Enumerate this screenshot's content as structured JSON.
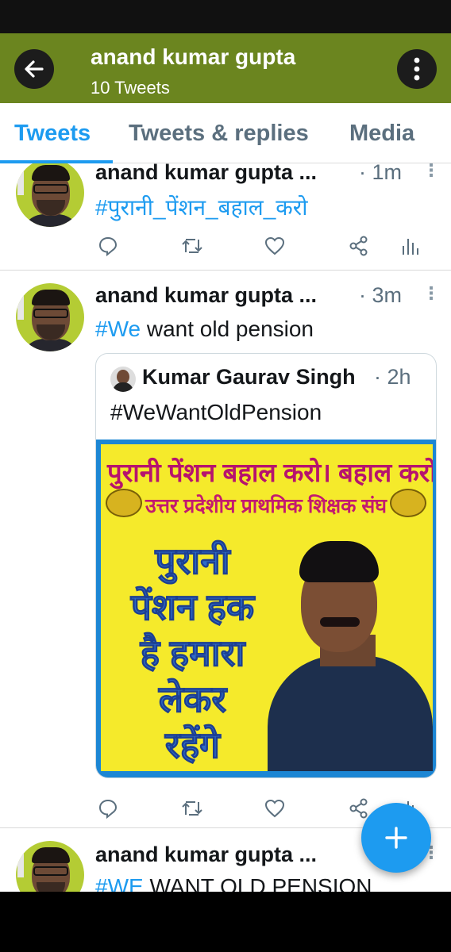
{
  "header": {
    "title": "anand kumar gupta",
    "subtitle": "10 Tweets",
    "bg_color": "#6b851f"
  },
  "tabs": [
    {
      "label": "Tweets",
      "active": true
    },
    {
      "label": "Tweets & replies",
      "active": false
    },
    {
      "label": "Media",
      "active": false
    }
  ],
  "tweets": [
    {
      "author": "anand kumar gupta ...",
      "time": "· 1m",
      "hashtag": "#पुरानी_पेंशन_बहाल_करो",
      "text": ""
    },
    {
      "author": "anand kumar gupta ...",
      "time": "· 3m",
      "hashtag": "#We",
      "text": " want old pension",
      "quote": {
        "author": "Kumar Gaurav Singh",
        "time": "· 2h",
        "text": "#WeWantOldPension",
        "poster": {
          "line1": "पुरानी पेंशन बहाल करो। बहाल करो।",
          "line2": "उत्तर प्रदेशीय प्राथमिक शिक्षक संघ",
          "slogan": [
            "पुरानी",
            "पेंशन हक",
            "है हमारा",
            "लेकर",
            "रहेंगे"
          ]
        }
      }
    },
    {
      "author": "anand kumar gupta ...",
      "time": "",
      "hashtag": "#WE",
      "text": " WANT OLD PENSION"
    }
  ],
  "icons": {
    "back": "arrow-left-icon",
    "more": "more-vertical-icon",
    "reply": "reply-icon",
    "retweet": "retweet-icon",
    "like": "heart-icon",
    "share": "share-icon",
    "analytics": "analytics-icon",
    "compose": "plus-icon"
  },
  "colors": {
    "accent": "#1d9bf0",
    "text": "#14171a",
    "muted": "#5b6f7e"
  }
}
